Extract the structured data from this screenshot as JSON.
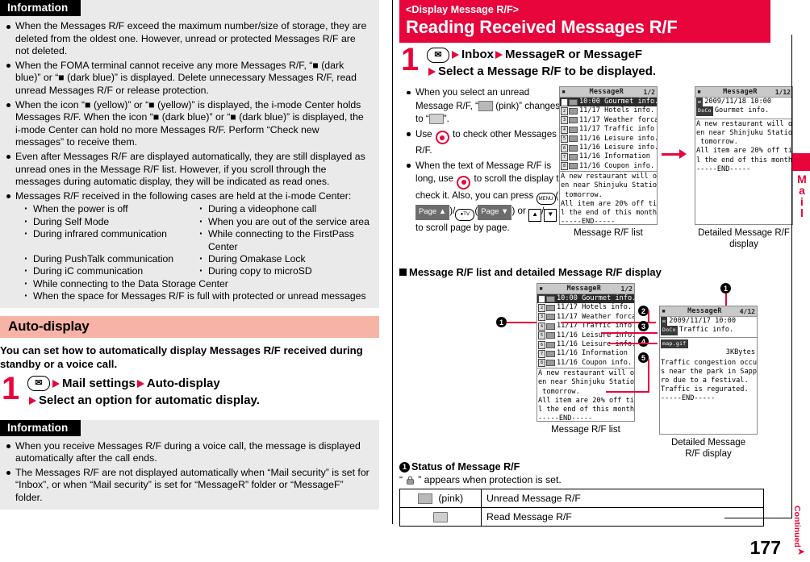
{
  "page_number": "177",
  "continued_label": "Continued",
  "side_tab": {
    "label": "Mail"
  },
  "colors": {
    "accent_red": "#e8053c",
    "section_pink": "#f7b3a6",
    "info_grey": "#eaeaea"
  },
  "left": {
    "info_top": {
      "heading": "Information",
      "bullets": [
        "When the Messages R/F exceed the maximum number/size of storage, they are deleted from the oldest one. However, unread or protected Messages R/F are not deleted.",
        "When the FOMA terminal cannot receive any more Messages R/F, “■ (dark blue)” or “■ (dark blue)” is displayed. Delete unnecessary Messages R/F, read unread Messages R/F or release protection.",
        "When the icon “■ (yellow)” or “■ (yellow)” is displayed, the i-mode Center holds Messages R/F. When the icon “■ (dark blue)” or “■ (dark blue)” is displayed, the i-mode Center can hold no more Messages R/F. Perform “Check new messages” to receive them.",
        "Even after Messages R/F are displayed automatically, they are still displayed as unread ones in the Message R/F list. However, if you scroll through the messages during automatic display, they will be indicated as read ones.",
        "Messages R/F received in the following cases are held at the i-mode Center:"
      ],
      "cases": [
        "When the power is off",
        "During a videophone call",
        "During Self Mode",
        "When you are out of the service area",
        "During infrared communication",
        "While connecting to the FirstPass Center",
        "During PushTalk communication",
        "During Omakase Lock",
        "During iC communication",
        "During copy to microSD"
      ],
      "cases_full": [
        "While connecting to the Data Storage Center",
        "When the space for Messages R/F is full with protected or unread messages"
      ]
    },
    "section": {
      "title": "Auto-display",
      "lead": "You can set how to automatically display Messages R/F received during standby or a voice call.",
      "step": {
        "number": "1",
        "key_icon": "mail-key-icon",
        "line1_parts": [
          "Mail settings",
          "Auto-display"
        ],
        "line2": "Select an option for automatic display."
      }
    },
    "info_bottom": {
      "heading": "Information",
      "bullets": [
        "When you receive Messages R/F during a voice call, the message is displayed automatically after the call ends.",
        "The Messages R/F are not displayed automatically when “Mail security” is set for “Inbox”, or when “Mail security” is set for “MessageR” folder or “MessageF” folder."
      ]
    }
  },
  "right": {
    "header": {
      "sub": "<Display Message R/F>",
      "main": "Reading Received Messages R/F"
    },
    "step": {
      "number": "1",
      "key_icon": "mail-key-icon",
      "line1_parts": [
        "Inbox",
        "MessageR or MessageF"
      ],
      "line2": "Select a Message R/F to be displayed."
    },
    "notes": [
      "When you select an unread Message R/F, “✉ (pink)” changes to “✉”.",
      "Use ◎ to check other Messages R/F.",
      "When the text of Message R/F is long, use ◎ to scroll the display to check it. Also, you can press MENU(Page ▲)/◎(Page ▼) or ▲/▼ to scroll page by page."
    ],
    "note3_keys": {
      "menu": "MENU",
      "page_up": "Page ▲",
      "camera": "TV",
      "page_down": "Page ▼"
    },
    "screens_top": {
      "list": {
        "caption": "Message R/F list",
        "title": "MessageR",
        "counter": "1/2",
        "rows": [
          {
            "date": "10:00",
            "text": "Gourmet info.",
            "selected": true
          },
          {
            "date": "11/17",
            "text": "Hotels info.",
            "selected": false
          },
          {
            "date": "11/17",
            "text": "Weather forcas",
            "selected": false
          },
          {
            "date": "11/17",
            "text": "Traffic info",
            "selected": false
          },
          {
            "date": "11/16",
            "text": "Leisure info.",
            "selected": false
          },
          {
            "date": "11/16",
            "text": "Leisure info.",
            "selected": false
          },
          {
            "date": "11/16",
            "text": "Information",
            "selected": false
          },
          {
            "date": "11/16",
            "text": "Coupon info.",
            "selected": false
          }
        ],
        "preview": "A new restaurant will op\nen near Shinjuku Station\n tomorrow.\nAll item are 20% off til\nl the end of this month.\n-----END-----"
      },
      "detail": {
        "caption": "Detailed Message R/F display",
        "title": "MessageR",
        "counter": "1/12",
        "datetime": "2009/11/18 10:00",
        "subject": "Gourmet info.",
        "subject_tag": "DoCo",
        "body": "A new restaurant will op\nen near Shinjuku Station\n tomorrow.\nAll item are 20% off til\nl the end of this month.\n-----END-----"
      }
    },
    "diagram": {
      "heading": "Message R/F list and detailed Message R/F display",
      "list": {
        "caption": "Message R/F list",
        "title": "MessageR",
        "counter": "1/2",
        "rows": [
          {
            "date": "10:00",
            "text": "Gourmet info.",
            "selected": true
          },
          {
            "date": "11/17",
            "text": "Hotels info.",
            "selected": false
          },
          {
            "date": "11/17",
            "text": "Weather forcas",
            "selected": false
          },
          {
            "date": "11/17",
            "text": "Traffic info",
            "selected": false
          },
          {
            "date": "11/16",
            "text": "Leisure info.",
            "selected": false
          },
          {
            "date": "11/16",
            "text": "Leisure info.",
            "selected": false
          },
          {
            "date": "11/16",
            "text": "Information",
            "selected": false
          },
          {
            "date": "11/16",
            "text": "Coupon info.",
            "selected": false
          }
        ],
        "preview": "A new restaurant will op\nen near Shinjuku Station\n tomorrow.\nAll item are 20% off til\nl the end of this month.\n-----END-----"
      },
      "detail": {
        "caption_l1": "Detailed Message",
        "caption_l2": "R/F display",
        "title": "MessageR",
        "counter": "4/12",
        "datetime": "2009/11/17 10:00",
        "subject": "Traffic info.",
        "subject_tag": "DoCo",
        "attachment": "map.gif",
        "attachment_size": "3KBytes",
        "body": "Traffic congestion occur\ns near the park in Sappo\nro due to a festival.\nTraffic is regurated.\n-----END-----"
      },
      "callouts": [
        "1",
        "2",
        "3",
        "4",
        "5"
      ]
    },
    "status": {
      "callout": "1",
      "title": "Status of Message R/F",
      "note": "“ ■ ” appears when protection is set.",
      "note_prefix": "“",
      "note_suffix": "” appears when protection is set.",
      "rows": [
        {
          "icon": "envelope-pink-icon",
          "icon_label": "(pink)",
          "desc": "Unread Message R/F"
        },
        {
          "icon": "envelope-open-icon",
          "icon_label": "",
          "desc": "Read Message R/F"
        }
      ]
    }
  }
}
